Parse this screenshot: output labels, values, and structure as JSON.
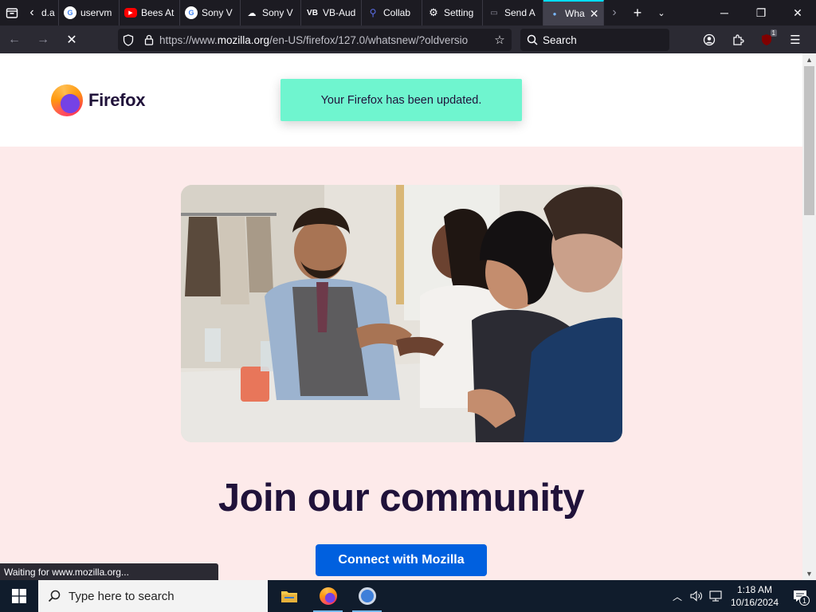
{
  "tabs": [
    {
      "label": "d.a",
      "favicon": "generic-page-icon"
    },
    {
      "label": "uservm",
      "favicon": "google-icon"
    },
    {
      "label": "Bees At",
      "favicon": "youtube-icon"
    },
    {
      "label": "Sony V",
      "favicon": "google-icon"
    },
    {
      "label": "Sony V",
      "favicon": "cloud-icon"
    },
    {
      "label": "VB-Aud",
      "favicon": "vb-audio-icon"
    },
    {
      "label": "Collab",
      "favicon": "search-icon"
    },
    {
      "label": "Setting",
      "favicon": "gear-icon"
    },
    {
      "label": "Send A",
      "favicon": "generic-page-icon"
    },
    {
      "label": "Wha",
      "favicon": "firefox-icon",
      "active": true
    }
  ],
  "urlbar": {
    "prefix": "https://www.",
    "domain": "mozilla.org",
    "path": "/en-US/firefox/127.0/whatsnew/?oldversio"
  },
  "searchbar": {
    "placeholder": "Search"
  },
  "extensions": {
    "ublock_count": "1"
  },
  "page": {
    "brand": "Firefox",
    "toast": "Your Firefox has been updated.",
    "headline": "Join our community",
    "cta": "Connect with Mozilla"
  },
  "status_text": "Waiting for www.mozilla.org...",
  "taskbar": {
    "search_placeholder": "Type here to search",
    "time": "1:18 AM",
    "date": "10/16/2024",
    "notification_count": "1"
  },
  "colors": {
    "page_bg": "#fdeaea",
    "toast_bg": "#6ff5cf",
    "cta_bg": "#0060df",
    "headline": "#20123a"
  }
}
